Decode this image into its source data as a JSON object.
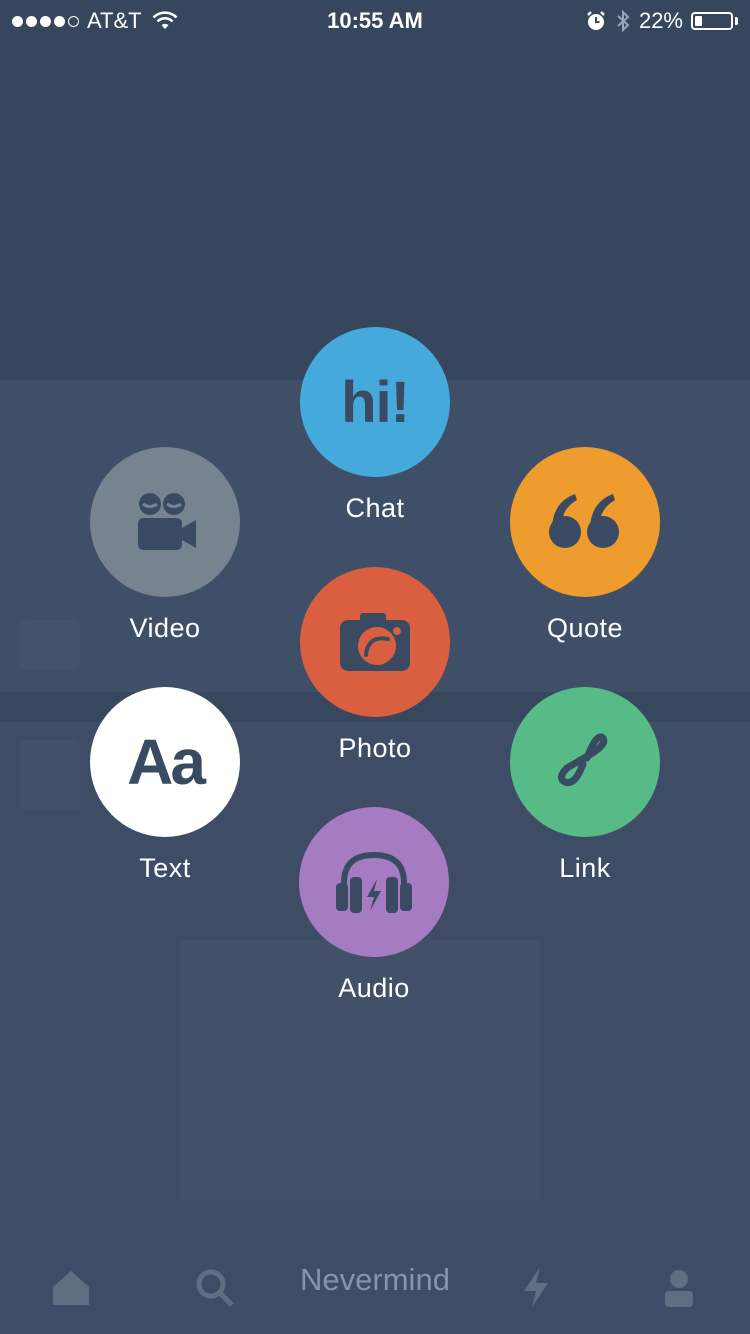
{
  "status_bar": {
    "carrier": "AT&T",
    "time": "10:55 AM",
    "battery": "22%",
    "battery_level": 0.22,
    "signal_bars": 4,
    "signal_total": 5
  },
  "menu": {
    "chat": {
      "label": "Chat",
      "icon": "chat-icon",
      "icon_text": "hi!",
      "color": "#45a9dc"
    },
    "video": {
      "label": "Video",
      "icon": "video-camera-icon",
      "color": "#77838f"
    },
    "quote": {
      "label": "Quote",
      "icon": "quote-icon",
      "color": "#ef9c2f"
    },
    "photo": {
      "label": "Photo",
      "icon": "camera-icon",
      "color": "#d95f40"
    },
    "text": {
      "label": "Text",
      "icon": "text-icon",
      "icon_text": "Aa",
      "color": "#ffffff"
    },
    "link": {
      "label": "Link",
      "icon": "link-icon",
      "color": "#56bb86"
    },
    "audio": {
      "label": "Audio",
      "icon": "headphones-icon",
      "color": "#a57bc2"
    }
  },
  "dismiss": {
    "label": "Nevermind"
  },
  "colors": {
    "background": "#3a4a62",
    "icon_dark": "#3a4a62",
    "dismiss_text": "#8594ab"
  }
}
